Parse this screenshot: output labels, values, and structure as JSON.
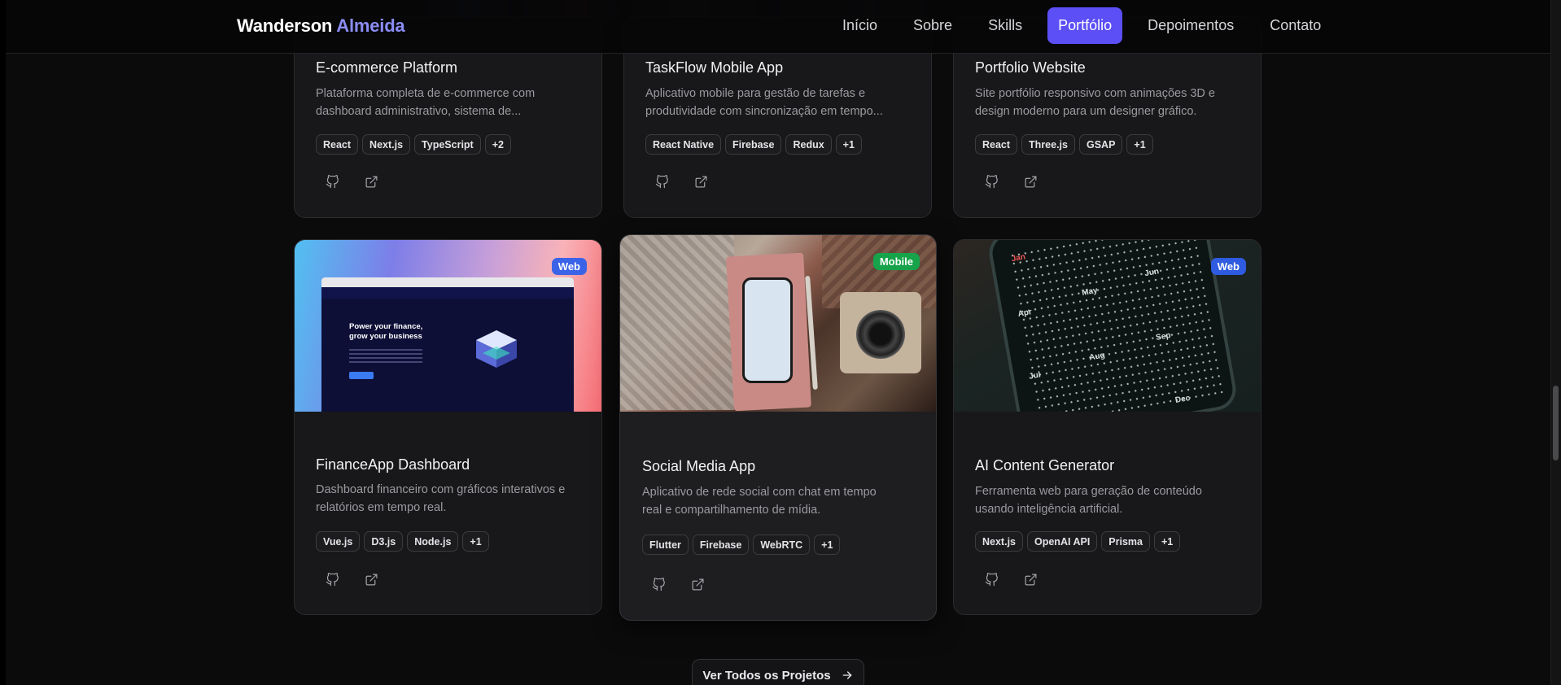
{
  "header": {
    "brand_first": "Wanderson",
    "brand_last": "Almeida",
    "nav": [
      "Início",
      "Sobre",
      "Skills",
      "Portfólio",
      "Depoimentos",
      "Contato"
    ],
    "active_nav": "Portfólio"
  },
  "projects_row1": [
    {
      "title": "E-commerce Platform",
      "desc_line1": "Plataforma completa de e-commerce com",
      "desc_line2": "dashboard administrativo, sistema de...",
      "tags": [
        "React",
        "Next.js",
        "TypeScript",
        "+2"
      ]
    },
    {
      "title": "TaskFlow Mobile App",
      "desc_line1": "Aplicativo mobile para gestão de tarefas e",
      "desc_line2": "produtividade com sincronização em tempo...",
      "tags": [
        "React Native",
        "Firebase",
        "Redux",
        "+1"
      ]
    },
    {
      "title": "Portfolio Website",
      "desc_line1": "Site portfólio responsivo com animações 3D e",
      "desc_line2": "design moderno para um designer gráfico.",
      "tags": [
        "React",
        "Three.js",
        "GSAP",
        "+1"
      ]
    }
  ],
  "projects_row2": [
    {
      "badge": "Web",
      "badge_color": "#3b63e8",
      "title": "FinanceApp Dashboard",
      "desc_line1": "Dashboard financeiro com gráficos interativos e",
      "desc_line2": "relatórios em tempo real.",
      "tags": [
        "Vue.js",
        "D3.js",
        "Node.js",
        "+1"
      ],
      "image_text": "Power your finance, grow your business"
    },
    {
      "badge": "Mobile",
      "badge_color": "#16a34a",
      "title": "Social Media App",
      "desc_line1": "Aplicativo de rede social com chat em tempo",
      "desc_line2": "real e compartilhamento de mídia.",
      "tags": [
        "Flutter",
        "Firebase",
        "WebRTC",
        "+1"
      ]
    },
    {
      "badge": "Web",
      "badge_color": "#2f5be0",
      "title": "AI Content Generator",
      "desc_line1": "Ferramenta web para geração de conteúdo",
      "desc_line2": "usando inteligência artificial.",
      "tags": [
        "Next.js",
        "OpenAI API",
        "Prisma",
        "+1"
      ],
      "image_months": [
        "Apr",
        "May",
        "Jun",
        "Jul",
        "Aug",
        "Sep",
        "Jan",
        "Dec"
      ]
    }
  ],
  "footer": {
    "more_button": "Ver Todos os Projetos"
  },
  "icons": {
    "github": "github-icon",
    "external": "external-link-icon",
    "arrow": "arrow-right-icon"
  }
}
